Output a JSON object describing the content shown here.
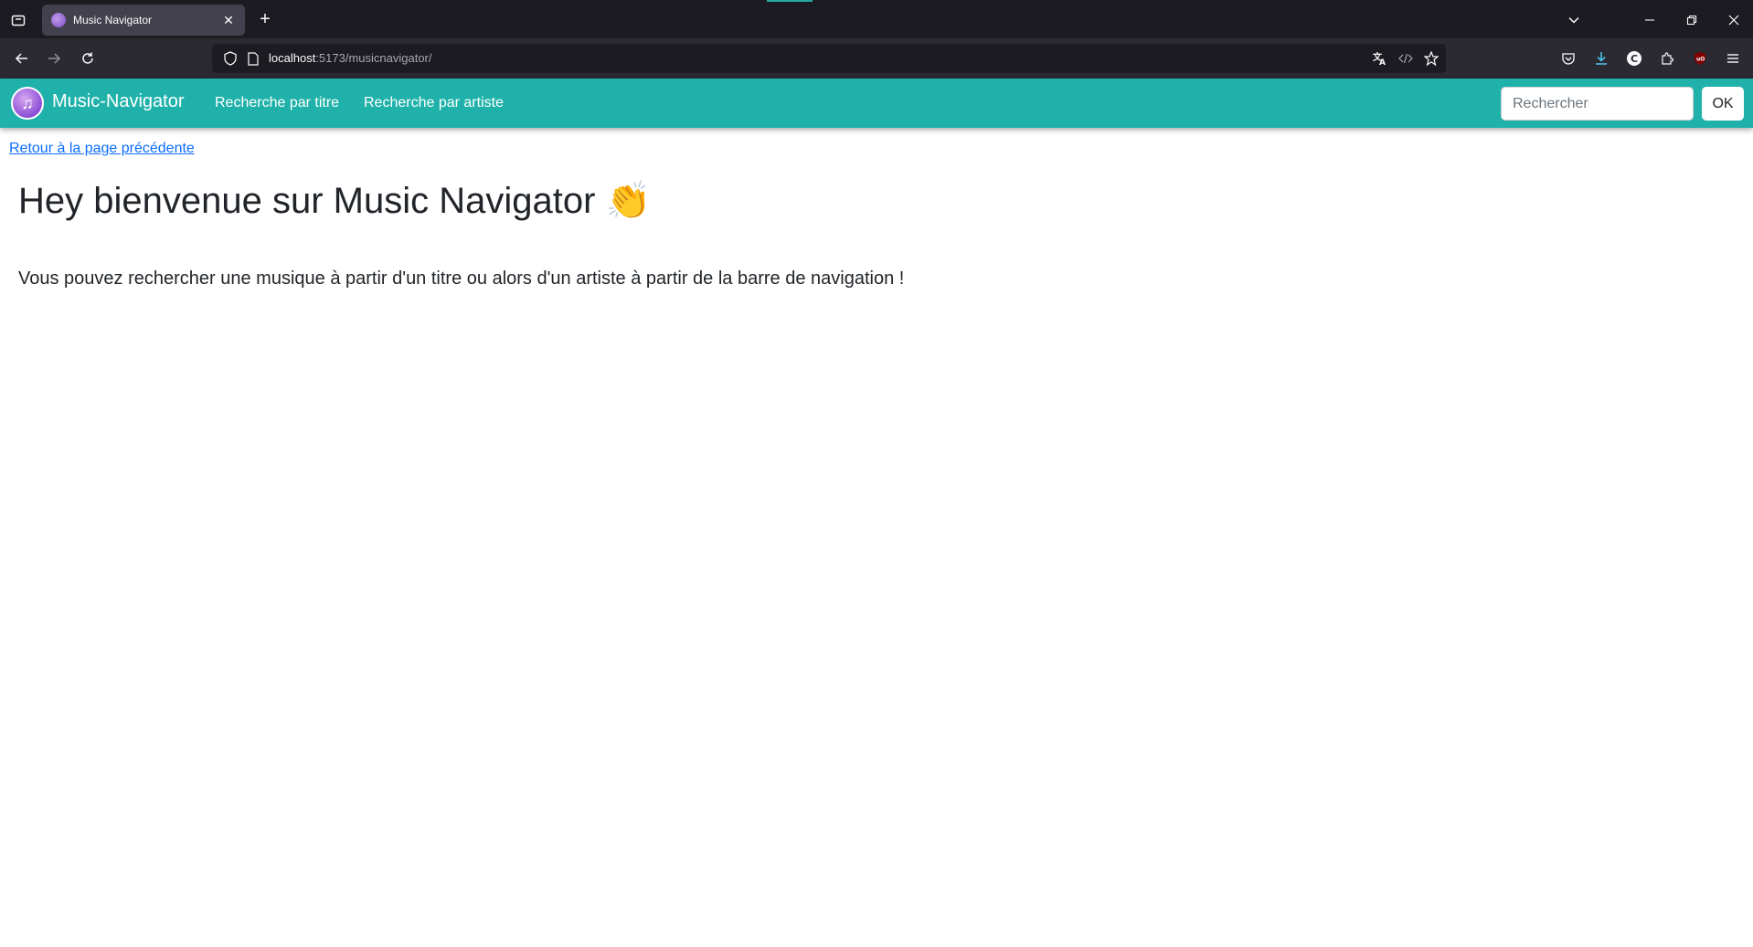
{
  "browser": {
    "tab": {
      "title": "Music Navigator"
    },
    "url": {
      "host": "localhost",
      "rest": ":5173/musicnavigator/"
    }
  },
  "app": {
    "brand": "Music-Navigator",
    "nav_links": [
      "Recherche par titre",
      "Recherche par artiste"
    ],
    "search": {
      "placeholder": "Rechercher",
      "button_label": "OK"
    }
  },
  "page": {
    "back_link": "Retour à la page précédente",
    "title": "Hey bienvenue sur Music Navigator 👏",
    "intro": "Vous pouvez rechercher une musique à partir d'un titre ou alors d'un artiste à partir de la barre de navigation !"
  },
  "colors": {
    "navbar": "#20b2aa",
    "link": "#0d6efd",
    "chrome_dark": "#1c1b22"
  }
}
